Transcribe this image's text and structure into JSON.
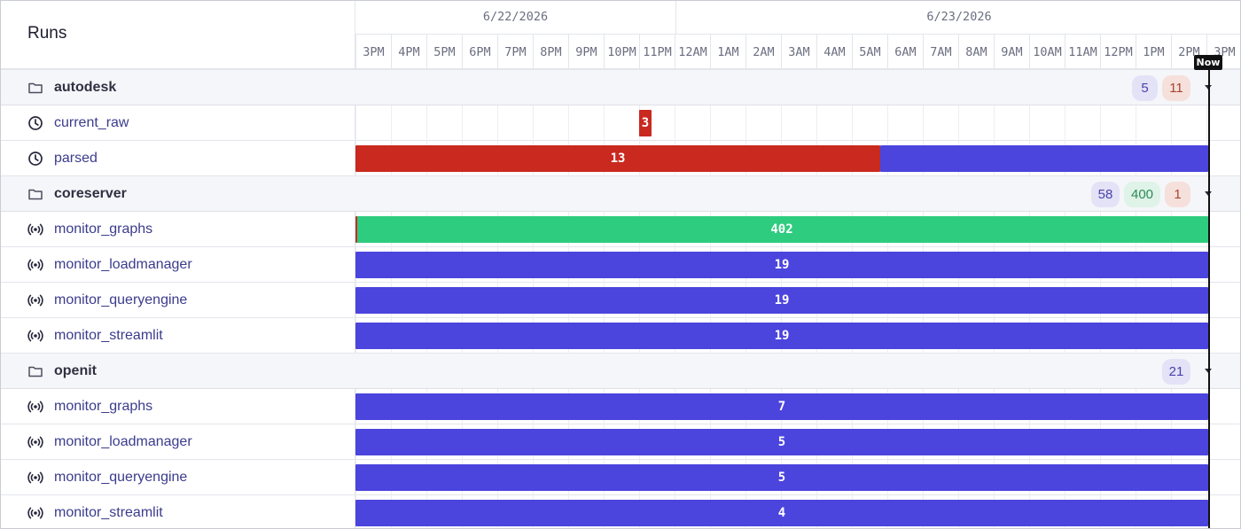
{
  "header": {
    "title": "Runs",
    "dates": [
      "6/22/2026",
      "6/23/2026"
    ],
    "hours": [
      "3PM",
      "4PM",
      "5PM",
      "6PM",
      "7PM",
      "8PM",
      "9PM",
      "10PM",
      "11PM",
      "12AM",
      "1AM",
      "2AM",
      "3AM",
      "4AM",
      "5AM",
      "6AM",
      "7AM",
      "8AM",
      "9AM",
      "10AM",
      "11AM",
      "12PM",
      "1PM",
      "2PM",
      "3PM"
    ],
    "now_label": "Now"
  },
  "groups": [
    {
      "name": "autodesk",
      "badges": [
        {
          "value": "5",
          "color": "blue"
        },
        {
          "value": "11",
          "color": "red"
        }
      ],
      "jobs": [
        {
          "name": "current_raw",
          "icon": "clock-icon",
          "bars": [
            {
              "label": "3",
              "color": "red",
              "start_hour": 8.0,
              "end_hour": 8.35
            }
          ]
        },
        {
          "name": "parsed",
          "icon": "clock-icon",
          "bars": [
            {
              "label": "13",
              "color": "red",
              "start_hour": 0.0,
              "end_hour": 14.8
            },
            {
              "label": "",
              "color": "blue",
              "start_hour": 14.8,
              "end_hour": 24.05
            }
          ]
        }
      ]
    },
    {
      "name": "coreserver",
      "badges": [
        {
          "value": "58",
          "color": "blue"
        },
        {
          "value": "400",
          "color": "green"
        },
        {
          "value": "1",
          "color": "red"
        }
      ],
      "jobs": [
        {
          "name": "monitor_graphs",
          "icon": "sensor-icon",
          "bars": [
            {
              "label": "402",
              "color": "green",
              "start_hour": 0.0,
              "end_hour": 24.05
            }
          ]
        },
        {
          "name": "monitor_loadmanager",
          "icon": "sensor-icon",
          "bars": [
            {
              "label": "19",
              "color": "blue",
              "start_hour": 0.0,
              "end_hour": 24.05
            }
          ]
        },
        {
          "name": "monitor_queryengine",
          "icon": "sensor-icon",
          "bars": [
            {
              "label": "19",
              "color": "blue",
              "start_hour": 0.0,
              "end_hour": 24.05
            }
          ]
        },
        {
          "name": "monitor_streamlit",
          "icon": "sensor-icon",
          "bars": [
            {
              "label": "19",
              "color": "blue",
              "start_hour": 0.0,
              "end_hour": 24.05
            }
          ]
        }
      ]
    },
    {
      "name": "openit",
      "badges": [
        {
          "value": "21",
          "color": "blue"
        }
      ],
      "jobs": [
        {
          "name": "monitor_graphs",
          "icon": "sensor-icon",
          "bars": [
            {
              "label": "7",
              "color": "blue",
              "start_hour": 0.0,
              "end_hour": 24.05
            }
          ]
        },
        {
          "name": "monitor_loadmanager",
          "icon": "sensor-icon",
          "bars": [
            {
              "label": "5",
              "color": "blue",
              "start_hour": 0.0,
              "end_hour": 24.05
            }
          ]
        },
        {
          "name": "monitor_queryengine",
          "icon": "sensor-icon",
          "bars": [
            {
              "label": "5",
              "color": "blue",
              "start_hour": 0.0,
              "end_hour": 24.05
            }
          ]
        },
        {
          "name": "monitor_streamlit",
          "icon": "sensor-icon",
          "bars": [
            {
              "label": "4",
              "color": "blue",
              "start_hour": 0.0,
              "end_hour": 24.05
            }
          ]
        }
      ]
    }
  ],
  "colors": {
    "run_success": "#2ecc7f",
    "run_failure": "#c9291f",
    "run_queued": "#4b44dd"
  }
}
